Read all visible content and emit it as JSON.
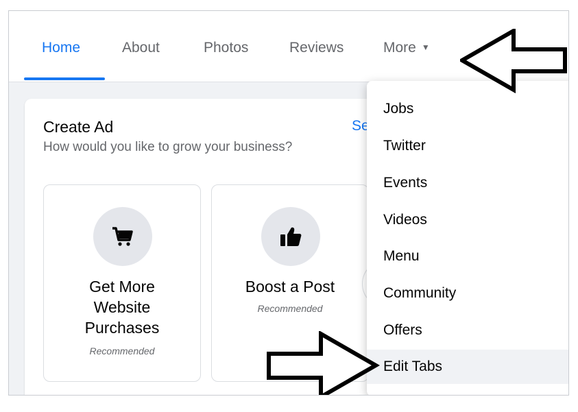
{
  "tabs": [
    {
      "label": "Home",
      "active": true
    },
    {
      "label": "About"
    },
    {
      "label": "Photos"
    },
    {
      "label": "Reviews"
    },
    {
      "label": "More",
      "has_dropdown": true
    }
  ],
  "create_ad": {
    "title": "Create Ad",
    "subtitle": "How would you like to grow your business?",
    "see_all_label": "Se",
    "options": [
      {
        "title_lines": [
          "Get More",
          "Website",
          "Purchases"
        ],
        "badge": "Recommended",
        "icon": "cart-icon"
      },
      {
        "title_lines": [
          "Boost a Post"
        ],
        "badge": "Recommended",
        "icon": "thumbs-up-icon"
      }
    ]
  },
  "more_menu": {
    "items": [
      "Jobs",
      "Twitter",
      "Events",
      "Videos",
      "Menu",
      "Community",
      "Offers",
      "Edit Tabs"
    ],
    "highlighted": "Edit Tabs"
  },
  "colors": {
    "accent": "#1877f2",
    "text_primary": "#050505",
    "text_secondary": "#65676b",
    "page_bg": "#f0f2f5"
  }
}
